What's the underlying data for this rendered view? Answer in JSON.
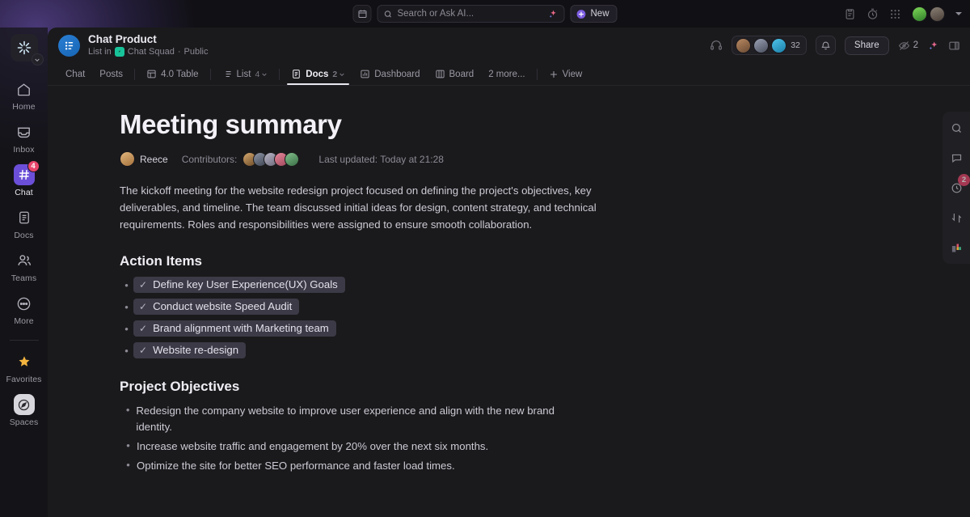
{
  "topbar": {
    "calendar_icon": "calendar-icon",
    "search": {
      "placeholder": "Search or Ask AI...",
      "icon": "search-icon",
      "ai_icon": "sparkle-icon"
    },
    "new_button": {
      "label": "New",
      "icon": "plus-circle-icon"
    },
    "right_icons": [
      "clipboard-icon",
      "stopwatch-icon",
      "apps-grid-icon"
    ],
    "avatar": "user-avatar",
    "chevron": "chevron-down-icon"
  },
  "sidebar": {
    "workspace_icon": "workspace-sparkle-icon",
    "items": [
      {
        "label": "Home",
        "icon": "home-icon",
        "active": false
      },
      {
        "label": "Inbox",
        "icon": "inbox-icon",
        "active": false
      },
      {
        "label": "Chat",
        "icon": "hash-icon",
        "active": true,
        "badge": "4"
      },
      {
        "label": "Docs",
        "icon": "doc-icon",
        "active": false
      },
      {
        "label": "Teams",
        "icon": "teams-icon",
        "active": false
      },
      {
        "label": "More",
        "icon": "ellipsis-icon",
        "active": false
      }
    ],
    "footer": [
      {
        "label": "Favorites",
        "icon": "star-icon"
      },
      {
        "label": "Spaces",
        "icon": "compass-icon"
      }
    ]
  },
  "header": {
    "title": "Chat Product",
    "subtitle_prefix": "List in",
    "space_name": "Chat Squad",
    "visibility": "Public",
    "separator": "·",
    "headphones_icon": "headphones-icon",
    "member_count": "32",
    "bell_icon": "bell-icon",
    "share_label": "Share",
    "views_icon": "eye-slash-icon",
    "views_count": "2",
    "ai_icon": "sparkle-icon",
    "layout_icon": "panel-toggle-icon"
  },
  "tabs": [
    {
      "label": "Chat",
      "icon": "",
      "count": "",
      "active": false
    },
    {
      "label": "Posts",
      "icon": "",
      "count": "",
      "active": false
    },
    {
      "label": "4.0 Table",
      "icon": "table-icon",
      "count": "",
      "active": false
    },
    {
      "label": "List",
      "icon": "list-icon",
      "count": "4",
      "active": false
    },
    {
      "label": "Docs",
      "icon": "doc-icon",
      "count": "2",
      "active": true
    },
    {
      "label": "Dashboard",
      "icon": "dashboard-icon",
      "count": "",
      "active": false
    },
    {
      "label": "Board",
      "icon": "board-icon",
      "count": "",
      "active": false
    },
    {
      "label": "2 more...",
      "icon": "",
      "count": "",
      "active": false
    },
    {
      "label": "View",
      "icon": "plus-icon",
      "count": "",
      "active": false
    }
  ],
  "doc": {
    "title": "Meeting summary",
    "author": "Reece",
    "contributors_label": "Contributors:",
    "contributors_count": 5,
    "last_updated": "Last updated: Today at 21:28",
    "intro": "The kickoff meeting for the website redesign project focused on defining the project's objectives, key deliverables, and timeline. The team discussed initial ideas for design, content strategy, and technical requirements. Roles and responsibilities were assigned to ensure smooth collaboration.",
    "action_items_heading": "Action Items",
    "action_items": [
      "Define key User Experience(UX) Goals",
      "Conduct website Speed Audit",
      "Brand alignment with Marketing team",
      "Website re-design"
    ],
    "objectives_heading": "Project Objectives",
    "objectives": [
      "Redesign the company website to improve user experience and align with the new brand identity.",
      "Increase website traffic and engagement by 20% over the next six months.",
      "Optimize the site for better SEO performance and faster load times."
    ]
  },
  "right_rail": [
    {
      "icon": "search-icon",
      "badge": ""
    },
    {
      "icon": "comment-icon",
      "badge": ""
    },
    {
      "icon": "history-icon",
      "badge": "2"
    },
    {
      "icon": "relationships-icon",
      "badge": ""
    },
    {
      "icon": "apps-icon",
      "badge": ""
    }
  ],
  "colors": {
    "accent_purple": "#6b4fd8",
    "badge_red": "#e8456b",
    "space_green": "#18c39a",
    "list_blue": "#1f76c9",
    "favorite_gold": "#f3b53f"
  }
}
